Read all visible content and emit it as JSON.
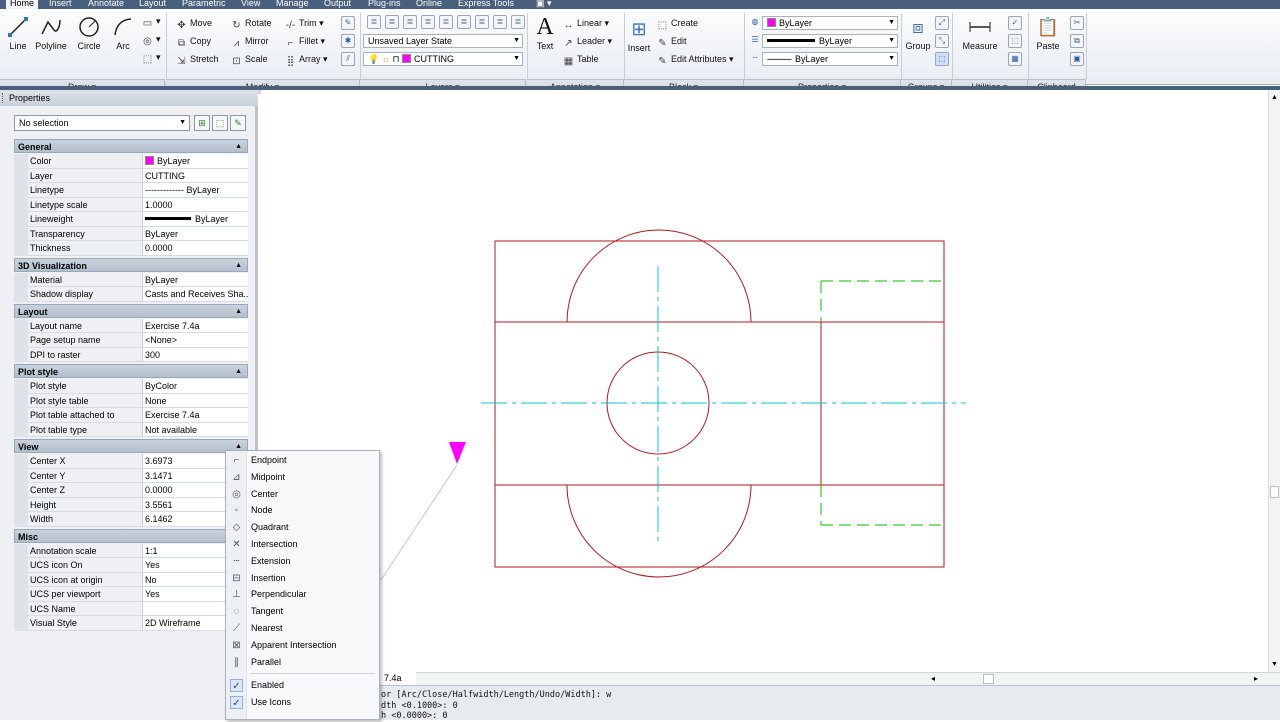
{
  "tabs": [
    "Home",
    "Insert",
    "Annotate",
    "Layout",
    "Parametric",
    "View",
    "Manage",
    "Output",
    "Plug-ins",
    "Online",
    "Express Tools"
  ],
  "ribbon": {
    "draw": {
      "panel": "Draw",
      "line": "Line",
      "polyline": "Polyline",
      "circle": "Circle",
      "arc": "Arc"
    },
    "modify": {
      "panel": "Modify",
      "move": "Move",
      "rotate": "Rotate",
      "trim": "Trim",
      "copy": "Copy",
      "mirror": "Mirror",
      "fillet": "Fillet",
      "stretch": "Stretch",
      "scale": "Scale",
      "array": "Array"
    },
    "layers": {
      "panel": "Layers",
      "layer_state": "Unsaved Layer State",
      "current_layer": "CUTTING"
    },
    "annotation": {
      "panel": "Annotation",
      "text": "Text",
      "linear": "Linear",
      "leader": "Leader",
      "table": "Table"
    },
    "block": {
      "panel": "Block",
      "insert": "Insert",
      "create": "Create",
      "edit": "Edit",
      "edit_attributes": "Edit Attributes"
    },
    "properties": {
      "panel": "Properties",
      "color": "ByLayer",
      "lineweight": "ByLayer",
      "linetype": "ByLayer"
    },
    "groups": {
      "panel": "Groups",
      "group": "Group"
    },
    "utilities": {
      "panel": "Utilities",
      "measure": "Measure"
    },
    "clipboard": {
      "panel": "Clipboard",
      "paste": "Paste"
    }
  },
  "properties_palette": {
    "title": "Properties",
    "selection": "No selection",
    "sections": [
      {
        "name": "General",
        "rows": [
          {
            "k": "Color",
            "v": "ByLayer"
          },
          {
            "k": "Layer",
            "v": "CUTTING"
          },
          {
            "k": "Linetype",
            "v": "------------- ByLayer"
          },
          {
            "k": "Linetype scale",
            "v": "1.0000"
          },
          {
            "k": "Lineweight",
            "v": "ByLayer"
          },
          {
            "k": "Transparency",
            "v": "ByLayer"
          },
          {
            "k": "Thickness",
            "v": "0.0000"
          }
        ]
      },
      {
        "name": "3D Visualization",
        "rows": [
          {
            "k": "Material",
            "v": "ByLayer"
          },
          {
            "k": "Shadow display",
            "v": "Casts and Receives Sha..."
          }
        ]
      },
      {
        "name": "Layout",
        "rows": [
          {
            "k": "Layout name",
            "v": "Exercise 7.4a"
          },
          {
            "k": "Page setup name",
            "v": "<None>"
          },
          {
            "k": "DPI to raster",
            "v": "300"
          }
        ]
      },
      {
        "name": "Plot style",
        "rows": [
          {
            "k": "Plot style",
            "v": "ByColor"
          },
          {
            "k": "Plot style table",
            "v": "None"
          },
          {
            "k": "Plot table attached to",
            "v": "Exercise 7.4a"
          },
          {
            "k": "Plot table type",
            "v": "Not available"
          }
        ]
      },
      {
        "name": "View",
        "rows": [
          {
            "k": "Center X",
            "v": "3.6973"
          },
          {
            "k": "Center Y",
            "v": "3.1471"
          },
          {
            "k": "Center Z",
            "v": "0.0000"
          },
          {
            "k": "Height",
            "v": "3.5561"
          },
          {
            "k": "Width",
            "v": "6.1462"
          }
        ]
      },
      {
        "name": "Misc",
        "rows": [
          {
            "k": "Annotation scale",
            "v": "1:1"
          },
          {
            "k": "UCS icon On",
            "v": "Yes"
          },
          {
            "k": "UCS icon at origin",
            "v": "No"
          },
          {
            "k": "UCS per viewport",
            "v": "Yes"
          },
          {
            "k": "UCS Name",
            "v": ""
          },
          {
            "k": "Visual Style",
            "v": "2D Wireframe"
          }
        ]
      }
    ]
  },
  "osnap_menu": {
    "items": [
      "Endpoint",
      "Midpoint",
      "Center",
      "Node",
      "Quadrant",
      "Intersection",
      "Extension",
      "Insertion",
      "Perpendicular",
      "Tangent",
      "Nearest",
      "Apparent Intersection",
      "Parallel"
    ],
    "toggles": [
      "Enabled",
      "Use Icons"
    ]
  },
  "layout_tab": "7.4a",
  "command_lines": [
    "or [Arc/Close/Halfwidth/Length/Undo/Width]: w",
    "dth <0.1000>: 0",
    "h <0.0000>: 0"
  ],
  "colors": {
    "ribbon_bg": "#e9edf2",
    "tab_bar": "#4a5f7c",
    "object_red": "#b0171f",
    "center_cyan": "#00c8d0",
    "hidden_green": "#00c000",
    "magenta": "#ff00ff"
  }
}
